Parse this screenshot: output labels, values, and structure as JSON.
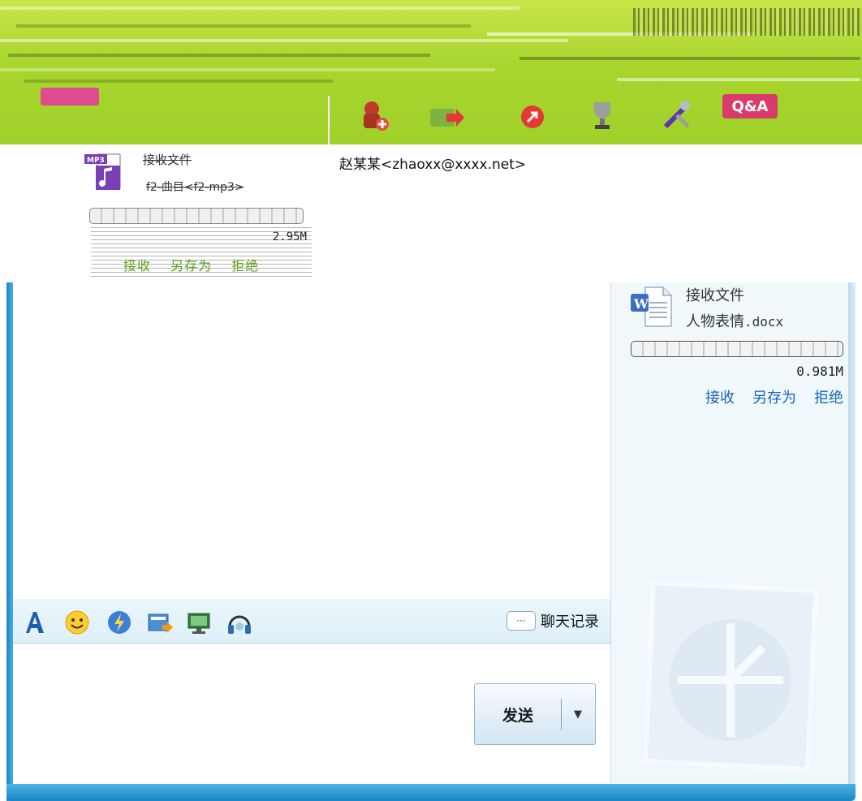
{
  "contact": {
    "display": "赵某某<zhaoxx@xxxx.net>"
  },
  "toolbar": {
    "qa_label": "Q&A",
    "tools": [
      "add-contact-icon",
      "send-file-icon",
      "share-icon",
      "trophy-icon",
      "tools-icon",
      "qa-icon"
    ]
  },
  "mp3_transfer": {
    "title": "接收文件",
    "filename": "f2-曲目<f2-mp3>",
    "size": "2.95M",
    "progress": 0,
    "actions": {
      "receive": "接收",
      "save_as": "另存为",
      "reject": "拒绝"
    }
  },
  "docx_transfer": {
    "title": "接收文件",
    "filename_cn": "人物表情",
    "filename_ext": ".docx",
    "size": "0.981M",
    "progress": 0,
    "actions": {
      "receive": "接收",
      "save_as": "另存为",
      "reject": "拒绝"
    }
  },
  "format_toolbar": {
    "history_label": "聊天记录"
  },
  "send": {
    "label": "发送",
    "arrow": "▼"
  },
  "colors": {
    "header_green": "#a9d52e",
    "frame_blue": "#1b86c6",
    "link_blue": "#1566b8",
    "qa_pink": "#d93b6a"
  }
}
